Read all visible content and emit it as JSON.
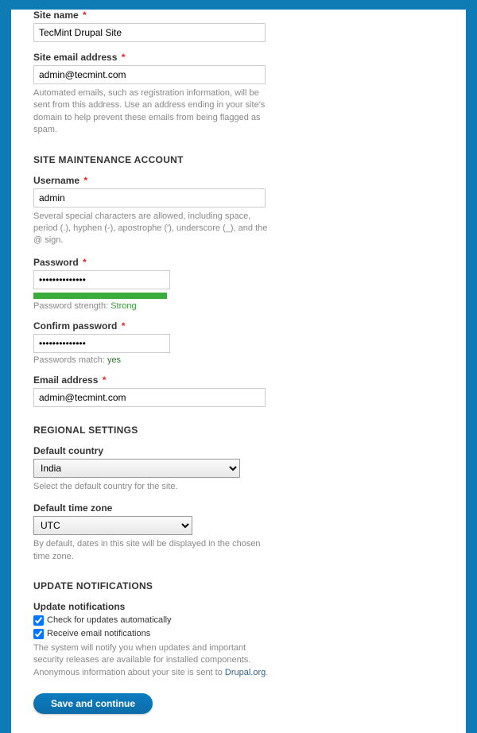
{
  "siteinfo": {
    "site_name_label": "Site name",
    "site_name_value": "TecMint Drupal Site",
    "site_email_label": "Site email address",
    "site_email_value": "admin@tecmint.com",
    "site_email_desc": "Automated emails, such as registration information, will be sent from this address. Use an address ending in your site's domain to help prevent these emails from being flagged as spam."
  },
  "maintenance": {
    "heading": "SITE MAINTENANCE ACCOUNT",
    "username_label": "Username",
    "username_value": "admin",
    "username_desc": "Several special characters are allowed, including space, period (.), hyphen (-), apostrophe ('), underscore (_), and the @ sign.",
    "password_label": "Password",
    "password_value": "••••••••••••••",
    "strength_label": "Password strength:",
    "strength_value": "Strong",
    "confirm_label": "Confirm password",
    "confirm_value": "••••••••••••••",
    "match_label": "Passwords match:",
    "match_value": "yes",
    "email_label": "Email address",
    "email_value": "admin@tecmint.com"
  },
  "regional": {
    "heading": "REGIONAL SETTINGS",
    "country_label": "Default country",
    "country_value": "India",
    "country_desc": "Select the default country for the site.",
    "tz_label": "Default time zone",
    "tz_value": "UTC",
    "tz_desc": "By default, dates in this site will be displayed in the chosen time zone."
  },
  "updates": {
    "heading": "UPDATE NOTIFICATIONS",
    "subheading": "Update notifications",
    "check_auto_label": "Check for updates automatically",
    "receive_email_label": "Receive email notifications",
    "desc_prefix": "The system will notify you when updates and important security releases are available for installed components. Anonymous information about your site is sent to ",
    "desc_link": "Drupal.org",
    "desc_suffix": "."
  },
  "submit": {
    "label": "Save and continue"
  }
}
